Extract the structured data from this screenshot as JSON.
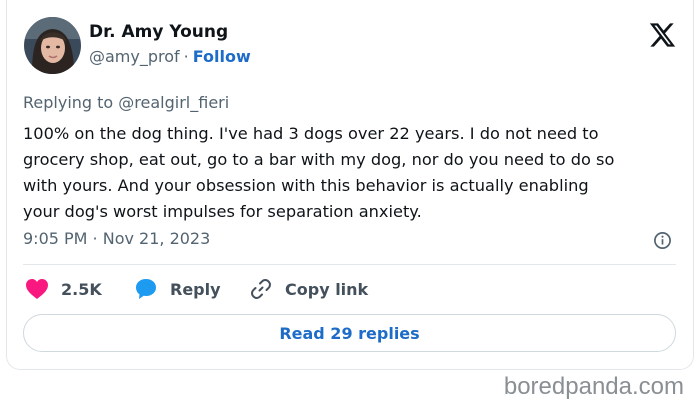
{
  "author": {
    "name": "Dr. Amy Young",
    "handle": "@amy_prof",
    "separator": "·",
    "follow_label": "Follow"
  },
  "icons": {
    "brand": "x-logo-icon",
    "info": "info-icon",
    "like": "heart-icon",
    "reply": "reply-bubble-icon",
    "copy": "link-icon"
  },
  "tweet": {
    "replying_to": "Replying to @realgirl_fieri",
    "text_lines": [
      "100% on the dog thing. I've had 3 dogs over 22 years. I do not need to",
      "grocery shop, eat out, go to a bar with my dog, nor do you need to do so",
      "with yours. And your obsession with this behavior is actually enabling",
      "your dog's worst impulses for separation anxiety."
    ],
    "timestamp": "9:05 PM · Nov 21, 2023"
  },
  "actions": {
    "likes": "2.5K",
    "reply_label": "Reply",
    "copy_label": "Copy link"
  },
  "read_replies_label": "Read 29 replies",
  "watermark": "boredpanda.com",
  "colors": {
    "accent": "#1d6cc8",
    "like": "#f91880",
    "reply_icon": "#1d9bf0",
    "muted": "#536471"
  }
}
